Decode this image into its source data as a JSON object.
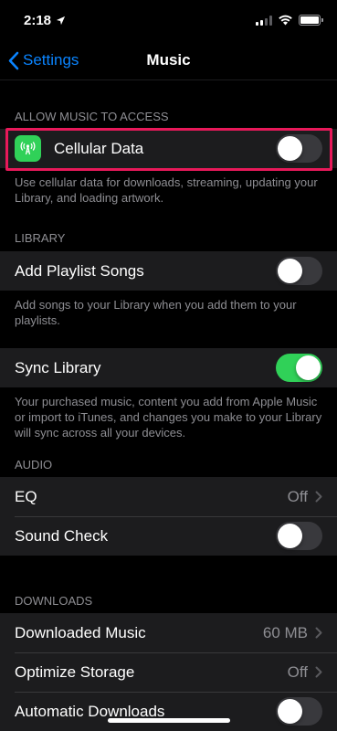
{
  "status_bar": {
    "time": "2:18"
  },
  "nav": {
    "back_label": "Settings",
    "title": "Music"
  },
  "sections": {
    "allow_access": {
      "header": "ALLOW MUSIC TO ACCESS",
      "cellular_label": "Cellular Data",
      "cellular_on": false,
      "footer": "Use cellular data for downloads, streaming, updating your Library, and loading artwork."
    },
    "library": {
      "header": "LIBRARY",
      "add_playlist_label": "Add Playlist Songs",
      "add_playlist_on": false,
      "add_playlist_footer": "Add songs to your Library when you add them to your playlists.",
      "sync_label": "Sync Library",
      "sync_on": true,
      "sync_footer": "Your purchased music, content you add from Apple Music or import to iTunes, and changes you make to your Library will sync across all your devices."
    },
    "audio": {
      "header": "AUDIO",
      "eq_label": "EQ",
      "eq_value": "Off",
      "sound_check_label": "Sound Check",
      "sound_check_on": false
    },
    "downloads": {
      "header": "DOWNLOADS",
      "downloaded_music_label": "Downloaded Music",
      "downloaded_music_value": "60 MB",
      "optimize_storage_label": "Optimize Storage",
      "optimize_storage_value": "Off",
      "automatic_downloads_label": "Automatic Downloads",
      "automatic_downloads_on": false
    }
  },
  "colors": {
    "background": "#000000",
    "cell": "#1c1c1e",
    "accent": "#0a84ff",
    "toggle_on": "#30d158",
    "highlight": "#e8195a"
  }
}
